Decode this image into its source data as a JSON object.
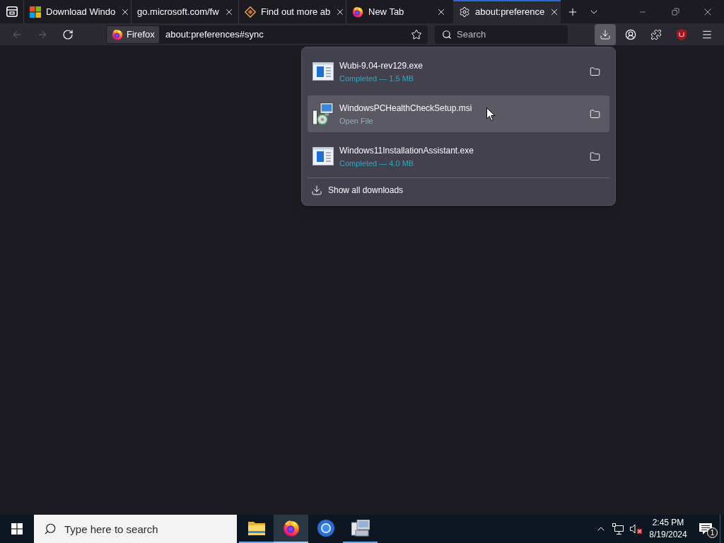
{
  "tab_strip": {
    "tabs": [
      {
        "title": "Download Windo",
        "kind": "windows",
        "selected": false
      },
      {
        "title": "go.microsoft.com/fw",
        "kind": "plain",
        "selected": false
      },
      {
        "title": "Find out more ab",
        "kind": "diamond",
        "selected": false
      },
      {
        "title": "New Tab",
        "kind": "firefox",
        "selected": false
      },
      {
        "title": "about:preference",
        "kind": "settings",
        "selected": true
      }
    ]
  },
  "toolbar": {
    "back": {
      "disabled": true
    },
    "forward": {
      "disabled": true
    },
    "identity_label": "Firefox",
    "url": "about:preferences#sync",
    "search": {
      "placeholder": "Search"
    },
    "downloads_button": {
      "active": true
    }
  },
  "downloads_panel": {
    "items": [
      {
        "name": "Wubi-9.04-rev129.exe",
        "status": "Completed — 1.5 MB",
        "kind": "exe",
        "highlighted": false
      },
      {
        "name": "WindowsPCHealthCheckSetup.msi",
        "status": "Open File",
        "kind": "msi",
        "highlighted": true
      },
      {
        "name": "Windows11InstallationAssistant.exe",
        "status": "Completed — 4.0 MB",
        "kind": "exe",
        "highlighted": false
      }
    ],
    "footer": "Show all downloads"
  },
  "taskbar": {
    "search": {
      "placeholder": "Type here to search"
    },
    "apps": [
      {
        "kind": "folder",
        "running": true,
        "active": false
      },
      {
        "kind": "firefox",
        "running": true,
        "active": true
      },
      {
        "kind": "browser",
        "running": false,
        "active": false
      },
      {
        "kind": "installer",
        "running": true,
        "active": false
      }
    ],
    "tray": {
      "volume_muted": true,
      "time": "2:45 PM",
      "date": "8/19/2024",
      "notification_count": "1"
    }
  }
}
